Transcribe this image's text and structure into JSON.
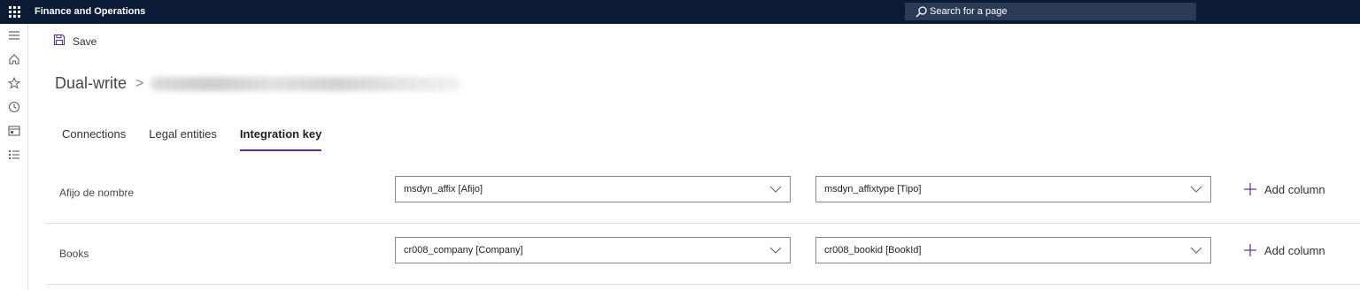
{
  "topbar": {
    "app_title": "Finance and Operations",
    "search_placeholder": "Search for a page"
  },
  "navrail": {
    "icons": [
      "menu-icon",
      "home-icon",
      "star-icon",
      "clock-icon",
      "workspace-icon",
      "list-icon"
    ]
  },
  "toolbar": {
    "save_label": "Save"
  },
  "breadcrumb": {
    "root": "Dual-write",
    "separator": ">"
  },
  "tabs": [
    {
      "label": "Connections",
      "active": false
    },
    {
      "label": "Legal entities",
      "active": false
    },
    {
      "label": "Integration key",
      "active": true
    }
  ],
  "rows": [
    {
      "label": "Afijo de nombre",
      "key1": "msdyn_affix [Afijo]",
      "key2": "msdyn_affixtype [Tipo]",
      "add_label": "Add column"
    },
    {
      "label": "Books",
      "key1": "cr008_company [Company]",
      "key2": "cr008_bookid [BookId]",
      "add_label": "Add column"
    }
  ],
  "colors": {
    "topbar": "#0b1b36",
    "accent": "#5c2e91",
    "search_box": "#2b3a55"
  }
}
